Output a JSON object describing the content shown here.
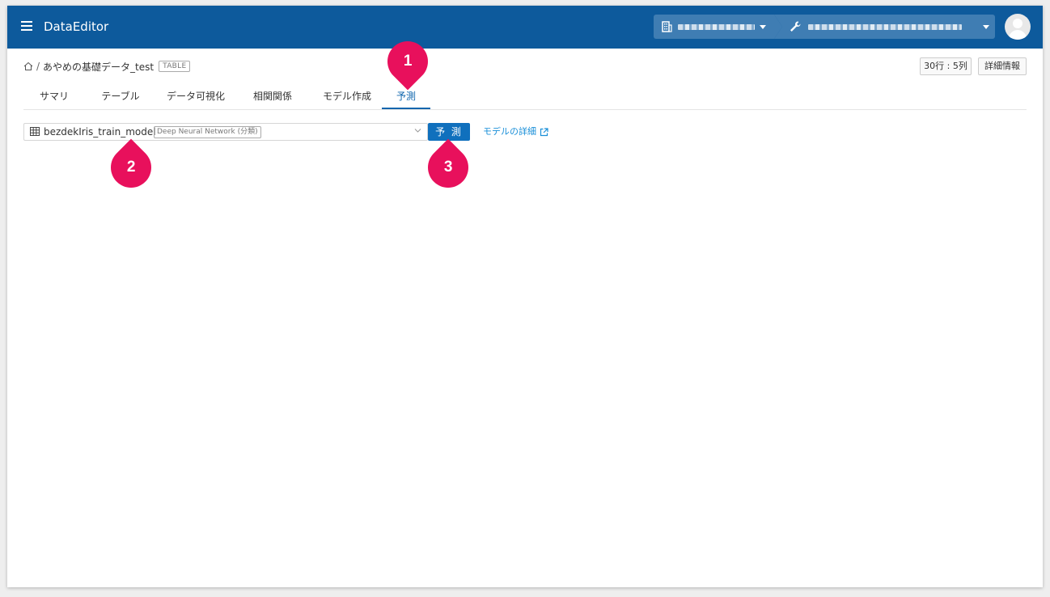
{
  "header": {
    "app_title": "DataEditor",
    "org_icon": "building-icon",
    "project_icon": "wrench-icon"
  },
  "breadcrumb": {
    "home_icon": "home-icon",
    "separator": "/",
    "dataset_name": "あやめの基礎データ_test",
    "badge": "TABLE"
  },
  "top_buttons": {
    "rows_cols": "30行 : 5列",
    "details": "詳細情報"
  },
  "tabs": [
    {
      "label": "サマリ"
    },
    {
      "label": "テーブル"
    },
    {
      "label": "データ可視化"
    },
    {
      "label": "相関関係"
    },
    {
      "label": "モデル作成"
    },
    {
      "label": "予測",
      "active": true
    }
  ],
  "predict": {
    "model_name": "bezdekIris_train_model",
    "model_type": "Deep Neural Network (分類)",
    "predict_button": "予 測",
    "detail_link": "モデルの詳細"
  },
  "markers": [
    "1",
    "2",
    "3"
  ],
  "colors": {
    "header_bg": "#0d5a9c",
    "accent": "#0e65ad",
    "marker": "#e8105c",
    "link": "#1a8fd8"
  }
}
